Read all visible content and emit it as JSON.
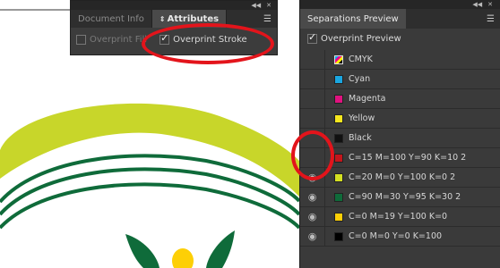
{
  "attributes_panel": {
    "tabs": [
      {
        "label": "Document Info",
        "active": false
      },
      {
        "label": "Attributes",
        "active": true
      }
    ],
    "overprint_fill": {
      "label": "Overprint Fill",
      "checked": false,
      "enabled": false
    },
    "overprint_stroke": {
      "label": "Overprint Stroke",
      "checked": true,
      "enabled": true
    }
  },
  "separations_panel": {
    "title": "Separations Preview",
    "overprint_preview": {
      "label": "Overprint Preview",
      "checked": true
    },
    "separations": [
      {
        "label": "CMYK",
        "color": "cmyk",
        "eye": false
      },
      {
        "label": "Cyan",
        "color": "#1aa6e0",
        "eye": false
      },
      {
        "label": "Magenta",
        "color": "#e0127f",
        "eye": false
      },
      {
        "label": "Yellow",
        "color": "#f6e71e",
        "eye": false
      },
      {
        "label": "Black",
        "color": "#111111",
        "eye": false
      },
      {
        "label": "C=15 M=100 Y=90 K=10 2",
        "color": "#c4161c",
        "eye": false
      },
      {
        "label": "C=20 M=0 Y=100 K=0 2",
        "color": "#d4e021",
        "eye": true
      },
      {
        "label": "C=90 M=30 Y=95 K=30 2",
        "color": "#0f6b3a",
        "eye": true
      },
      {
        "label": "C=0 M=19 Y=100 K=0",
        "color": "#fdcf06",
        "eye": true
      },
      {
        "label": "C=0 M=0 Y=0 K=100",
        "color": "#000000",
        "eye": true
      }
    ]
  },
  "colors": {
    "annotation_red": "#e3141b",
    "panel_bg": "#3a3a3a",
    "lime": "#c8d62a",
    "dark_green": "#0f6b3a",
    "yellow": "#fdcf06"
  }
}
